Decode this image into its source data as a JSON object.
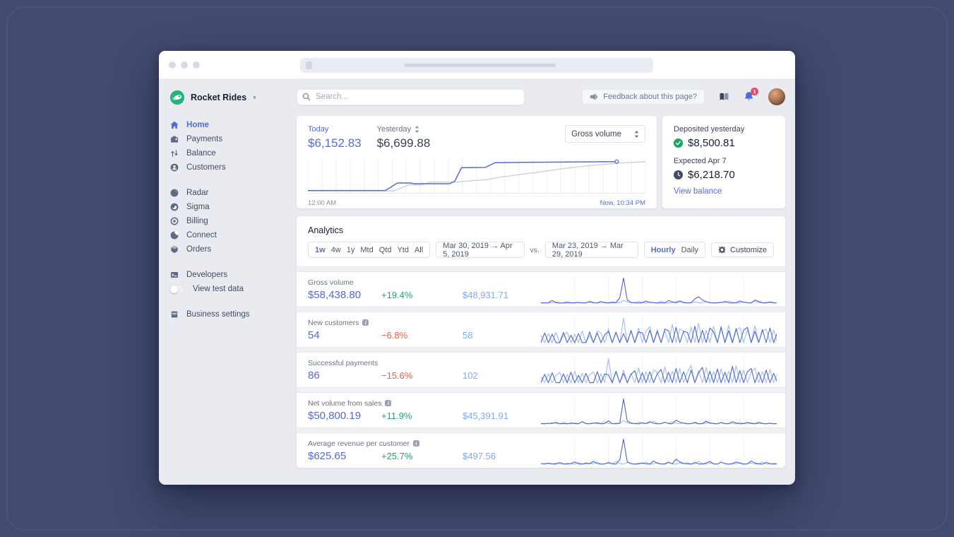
{
  "colors": {
    "accent": "#556cd6",
    "current": "#5469d4",
    "previous": "#7dabf8",
    "positive": "#1ea672",
    "negative": "#eb5e41",
    "brand_green": "#23b47e",
    "spark_prev": "#9dbef5",
    "spark_current": "#5165cf",
    "yesterday_line": "#c8cedb"
  },
  "sidebar": {
    "brand": {
      "name": "Rocket Rides"
    },
    "sections": [
      {
        "items": [
          {
            "id": "home",
            "label": "Home",
            "active": true
          },
          {
            "id": "payments",
            "label": "Payments"
          },
          {
            "id": "balance",
            "label": "Balance"
          },
          {
            "id": "customers",
            "label": "Customers"
          }
        ]
      },
      {
        "items": [
          {
            "id": "radar",
            "label": "Radar"
          },
          {
            "id": "sigma",
            "label": "Sigma"
          },
          {
            "id": "billing",
            "label": "Billing"
          },
          {
            "id": "connect",
            "label": "Connect"
          },
          {
            "id": "orders",
            "label": "Orders"
          }
        ]
      },
      {
        "items": [
          {
            "id": "developers",
            "label": "Developers"
          },
          {
            "id": "test-data",
            "label": "View test data",
            "toggle": true
          }
        ]
      },
      {
        "items": [
          {
            "id": "business-settings",
            "label": "Business settings"
          }
        ]
      }
    ]
  },
  "header": {
    "search_placeholder": "Search...",
    "feedback_label": "Feedback about this page?",
    "notification_count": "1"
  },
  "today_card": {
    "today_label": "Today",
    "today_value": "$6,152.83",
    "yesterday_label": "Yesterday",
    "yesterday_value": "$6,699.88",
    "metric_select_value": "Gross volume",
    "axis_start": "12:00 AM",
    "axis_end": "Now, 10:34 PM",
    "chart": {
      "type": "line",
      "gridlines": 24,
      "today_points": [
        [
          0,
          0.05
        ],
        [
          0.23,
          0.05
        ],
        [
          0.265,
          0.27
        ],
        [
          0.305,
          0.27
        ],
        [
          0.315,
          0.25
        ],
        [
          0.42,
          0.25
        ],
        [
          0.435,
          0.32
        ],
        [
          0.455,
          0.72
        ],
        [
          0.525,
          0.73
        ],
        [
          0.555,
          0.87
        ],
        [
          0.64,
          0.88
        ],
        [
          0.78,
          0.89
        ],
        [
          0.915,
          0.9
        ]
      ],
      "yesterday_points": [
        [
          0,
          0.04
        ],
        [
          0.255,
          0.04
        ],
        [
          0.3,
          0.22
        ],
        [
          0.335,
          0.21
        ],
        [
          0.365,
          0.3
        ],
        [
          0.44,
          0.3
        ],
        [
          0.475,
          0.33
        ],
        [
          0.53,
          0.37
        ],
        [
          0.575,
          0.45
        ],
        [
          0.63,
          0.52
        ],
        [
          0.69,
          0.6
        ],
        [
          0.76,
          0.7
        ],
        [
          0.83,
          0.78
        ],
        [
          0.91,
          0.85
        ],
        [
          1,
          0.9
        ]
      ]
    }
  },
  "deposit_card": {
    "deposited_label": "Deposited yesterday",
    "deposited_value": "$8,500.81",
    "expected_label": "Expected Apr 7",
    "expected_value": "$6,218.70",
    "link_label": "View balance"
  },
  "analytics": {
    "title": "Analytics",
    "ranges": [
      "1w",
      "4w",
      "1y",
      "Mtd",
      "Qtd",
      "Ytd",
      "All"
    ],
    "active_range": "1w",
    "period": "Mar 30, 2019 →  Apr 5, 2019",
    "vs_label": "vs.",
    "compare_period": "Mar 23, 2019 → Mar 29, 2019",
    "granularity": [
      "Hourly",
      "Daily"
    ],
    "active_granularity": "Hourly",
    "customize_label": "Customize",
    "rows": [
      {
        "label": "Gross volume",
        "has_info": false,
        "value": "$58,438.80",
        "delta": "+19.4%",
        "delta_dir": "up",
        "previous": "$48,931.71",
        "spark": {
          "current": [
            3,
            2,
            3,
            12,
            3,
            2,
            2,
            3,
            2,
            3,
            4,
            2,
            3,
            6,
            3,
            2,
            8,
            3,
            2,
            3,
            3,
            22,
            100,
            14,
            4,
            3,
            2,
            3,
            10,
            4,
            3,
            2,
            3,
            2,
            12,
            6,
            3,
            8,
            3,
            2,
            3,
            18,
            26,
            14,
            6,
            3,
            2,
            3,
            4,
            8,
            3,
            2,
            3,
            10,
            5,
            3,
            2,
            14,
            8,
            3,
            2,
            6,
            3,
            2
          ],
          "previous": [
            2,
            3,
            2,
            4,
            6,
            2,
            3,
            8,
            3,
            2,
            4,
            3,
            2,
            10,
            4,
            2,
            3,
            5,
            3,
            8,
            4,
            3,
            12,
            6,
            3,
            2,
            8,
            4,
            2,
            6,
            3,
            2,
            9,
            4,
            2,
            3,
            7,
            12,
            5,
            3,
            2,
            6,
            3,
            2,
            8,
            4,
            3,
            2,
            5,
            3,
            10,
            4,
            2,
            3,
            6,
            3,
            2,
            9,
            4,
            2,
            5,
            3,
            2,
            3
          ]
        }
      },
      {
        "label": "New customers",
        "has_info": true,
        "value": "54",
        "delta": "−6.8%",
        "delta_dir": "down",
        "previous": "58",
        "spark": {
          "current": [
            4,
            38,
            4,
            34,
            4,
            4,
            40,
            4,
            30,
            4,
            36,
            4,
            4,
            42,
            4,
            38,
            4,
            32,
            44,
            4,
            40,
            4,
            36,
            4,
            46,
            4,
            42,
            38,
            4,
            48,
            4,
            44,
            4,
            52,
            46,
            4,
            58,
            4,
            44,
            40,
            4,
            62,
            4,
            48,
            4,
            56,
            42,
            4,
            60,
            4,
            46,
            4,
            54,
            4,
            48,
            58,
            4,
            44,
            4,
            50,
            4,
            56,
            4,
            42
          ],
          "previous": [
            30,
            4,
            36,
            4,
            40,
            4,
            28,
            42,
            4,
            34,
            4,
            44,
            4,
            30,
            4,
            46,
            38,
            4,
            52,
            4,
            42,
            4,
            90,
            4,
            48,
            4,
            56,
            4,
            44,
            60,
            4,
            50,
            4,
            46,
            4,
            68,
            4,
            52,
            44,
            4,
            58,
            4,
            72,
            4,
            48,
            4,
            62,
            4,
            54,
            4,
            66,
            4,
            46,
            58,
            4,
            50,
            4,
            64,
            4,
            44,
            52,
            4,
            48,
            4
          ]
        }
      },
      {
        "label": "Successful payments",
        "has_info": false,
        "value": "86",
        "delta": "−15.6%",
        "delta_dir": "down",
        "previous": "102",
        "spark": {
          "current": [
            5,
            36,
            5,
            42,
            5,
            5,
            38,
            5,
            44,
            5,
            32,
            5,
            40,
            5,
            5,
            46,
            5,
            38,
            34,
            5,
            48,
            5,
            40,
            5,
            36,
            50,
            5,
            42,
            5,
            46,
            5,
            38,
            54,
            5,
            44,
            5,
            58,
            5,
            46,
            5,
            52,
            5,
            42,
            62,
            5,
            48,
            5,
            56,
            5,
            44,
            5,
            66,
            5,
            50,
            5,
            46,
            58,
            5,
            44,
            5,
            52,
            5,
            40,
            5
          ],
          "previous": [
            28,
            5,
            38,
            5,
            32,
            44,
            5,
            36,
            5,
            48,
            5,
            40,
            5,
            34,
            46,
            5,
            38,
            5,
            95,
            5,
            44,
            5,
            52,
            5,
            40,
            5,
            60,
            5,
            46,
            5,
            54,
            42,
            5,
            64,
            5,
            48,
            5,
            58,
            5,
            44,
            70,
            5,
            50,
            5,
            62,
            5,
            46,
            5,
            56,
            5,
            48,
            5,
            68,
            5,
            52,
            5,
            44,
            60,
            5,
            46,
            5,
            54,
            5,
            40
          ]
        }
      },
      {
        "label": "Net volume from sales",
        "has_info": true,
        "value": "$50,800.19",
        "delta": "+11.9%",
        "delta_dir": "up",
        "previous": "$45,391.91",
        "spark": {
          "current": [
            3,
            2,
            4,
            3,
            8,
            2,
            3,
            2,
            5,
            3,
            2,
            10,
            3,
            2,
            4,
            6,
            2,
            3,
            14,
            3,
            2,
            4,
            98,
            12,
            5,
            3,
            2,
            6,
            3,
            10,
            4,
            2,
            3,
            8,
            3,
            2,
            16,
            8,
            4,
            2,
            3,
            6,
            2,
            3,
            12,
            4,
            3,
            2,
            7,
            3,
            2,
            10,
            5,
            2,
            3,
            8,
            3,
            2,
            5,
            3,
            2,
            4,
            2,
            3
          ],
          "previous": [
            2,
            4,
            2,
            6,
            3,
            2,
            8,
            3,
            2,
            5,
            3,
            9,
            2,
            3,
            6,
            2,
            4,
            10,
            3,
            2,
            5,
            3,
            14,
            6,
            3,
            2,
            8,
            4,
            2,
            6,
            12,
            3,
            2,
            7,
            3,
            10,
            4,
            2,
            6,
            3,
            2,
            9,
            3,
            2,
            5,
            8,
            2,
            3,
            6,
            2,
            4,
            3,
            2,
            8,
            3,
            2,
            6,
            3,
            10,
            4,
            2,
            5,
            3,
            2
          ]
        }
      },
      {
        "label": "Average revenue per customer",
        "has_info": true,
        "value": "$625.65",
        "delta": "+25.7%",
        "delta_dir": "up",
        "previous": "$497.56",
        "spark": {
          "current": [
            4,
            3,
            5,
            3,
            2,
            8,
            3,
            2,
            4,
            10,
            3,
            2,
            6,
            3,
            12,
            4,
            2,
            3,
            8,
            3,
            2,
            18,
            96,
            10,
            4,
            2,
            3,
            6,
            3,
            2,
            14,
            5,
            3,
            2,
            8,
            3,
            20,
            10,
            4,
            3,
            2,
            8,
            3,
            2,
            6,
            12,
            3,
            2,
            9,
            4,
            2,
            3,
            10,
            5,
            2,
            3,
            14,
            6,
            3,
            2,
            8,
            4,
            2,
            3
          ],
          "previous": [
            3,
            2,
            4,
            2,
            6,
            3,
            2,
            5,
            3,
            2,
            8,
            3,
            2,
            6,
            3,
            10,
            2,
            3,
            5,
            3,
            12,
            4,
            2,
            8,
            3,
            2,
            6,
            3,
            9,
            2,
            3,
            7,
            2,
            4,
            10,
            3,
            2,
            6,
            3,
            8,
            2,
            3,
            12,
            4,
            2,
            6,
            3,
            2,
            9,
            3,
            2,
            5,
            3,
            8,
            2,
            4,
            6,
            2,
            3,
            10,
            3,
            2,
            5,
            3
          ]
        }
      }
    ]
  }
}
